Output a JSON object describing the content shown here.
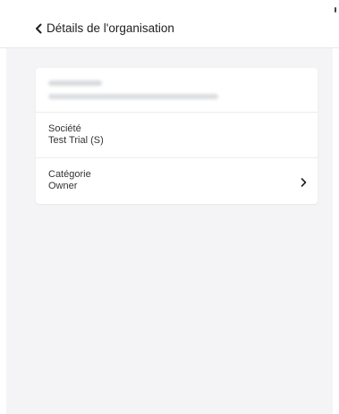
{
  "header": {
    "title": "Détails de l'organisation",
    "back_icon": "chevron-left-icon"
  },
  "card": {
    "user": {
      "name": "",
      "email": ""
    },
    "fields": [
      {
        "label": "Société",
        "value": "Test Trial (S)",
        "clickable": false
      },
      {
        "label": "Catégorie",
        "value": "Owner",
        "clickable": true,
        "icon": "chevron-right-icon"
      }
    ]
  },
  "colors": {
    "background": "#f4f4f6",
    "card": "#ffffff",
    "divider": "#ececef",
    "text": "#333333"
  }
}
